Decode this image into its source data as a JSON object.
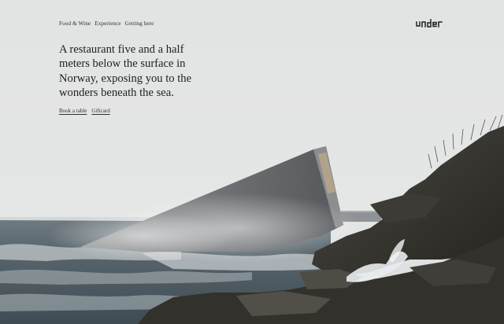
{
  "nav": {
    "items": [
      "Food & Wine",
      "Experience",
      "Getting here"
    ]
  },
  "brand": {
    "logo_text": "under"
  },
  "hero": {
    "headline": "A restaurant five and a half meters below the surface in Norway, exposing you to the wonders beneath the sea.",
    "actions": [
      "Book a table",
      "Giftcard"
    ]
  },
  "colors": {
    "sky": "#e3e4e4",
    "text": "#2b2b2b",
    "sea": "#4a5860",
    "rock": "#2f2e2c",
    "building": "#5d6063"
  }
}
